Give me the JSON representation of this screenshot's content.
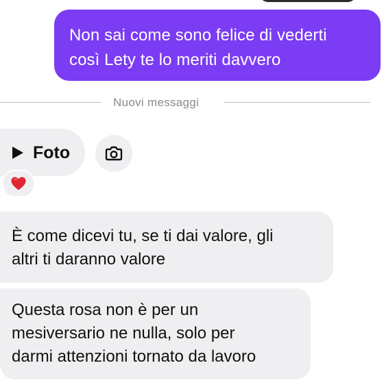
{
  "conversation": {
    "outgoing": [
      {
        "text": "Non sai come sono felice di vederti\ncosì Lety te lo meriti davvero"
      }
    ],
    "divider_label": "Nuovi messaggi",
    "incoming": {
      "media_pill_label": "Foto",
      "reaction_emoji": "heart",
      "messages": [
        {
          "text": "È come dicevi tu, se ti dai valore, gli\naltri ti daranno valore"
        },
        {
          "text": "Questa rosa non è per un\nmesiversario ne nulla, solo per\ndarmi attenzioni tornato da lavoro"
        }
      ]
    }
  },
  "colors": {
    "outgoing_bubble": "#7b3cf3",
    "incoming_bubble": "#efeff2",
    "divider_text": "#8a8a8f",
    "heart": "#e0262f"
  },
  "icons": [
    "play-icon",
    "camera-icon",
    "heart-icon"
  ]
}
